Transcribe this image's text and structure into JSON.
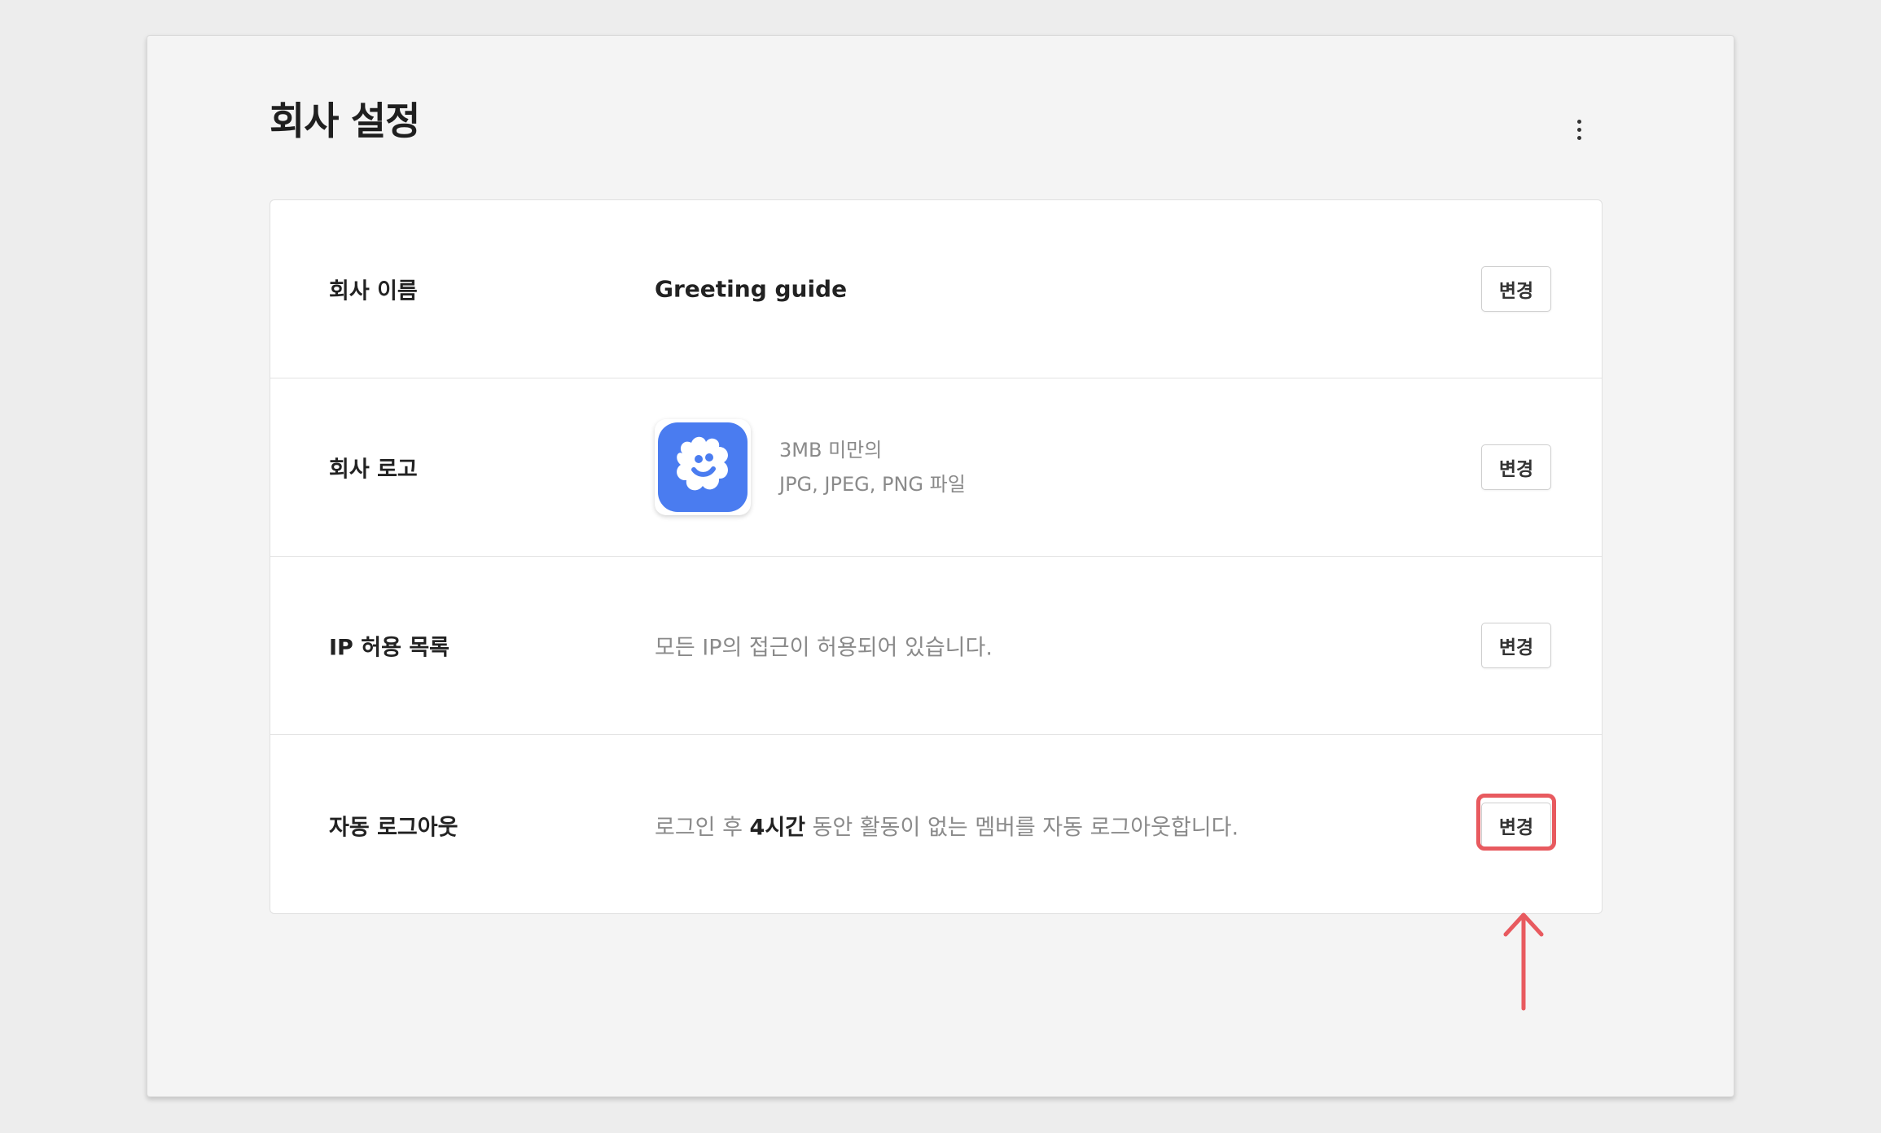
{
  "page": {
    "title": "회사 설정",
    "more_icon": "more-vertical-icon"
  },
  "settings": {
    "company_name": {
      "label": "회사 이름",
      "value": "Greeting guide",
      "button": "변경"
    },
    "company_logo": {
      "label": "회사 로고",
      "hint_line1": "3MB 미만의",
      "hint_line2": "JPG, JPEG, PNG 파일",
      "logo_icon": "greeting-logo-icon",
      "logo_color": "#4a7cf0",
      "button": "변경"
    },
    "ip_allowlist": {
      "label": "IP 허용 목록",
      "value": "모든 IP의 접근이 허용되어 있습니다.",
      "button": "변경"
    },
    "auto_logout": {
      "label": "자동 로그아웃",
      "value_prefix": "로그인 후 ",
      "value_highlight": "4시간",
      "value_suffix": " 동안 활동이 없는 멤버를 자동 로그아웃합니다.",
      "button": "변경"
    }
  },
  "annotation": {
    "color": "#e85a5f",
    "target": "auto_logout.button"
  }
}
